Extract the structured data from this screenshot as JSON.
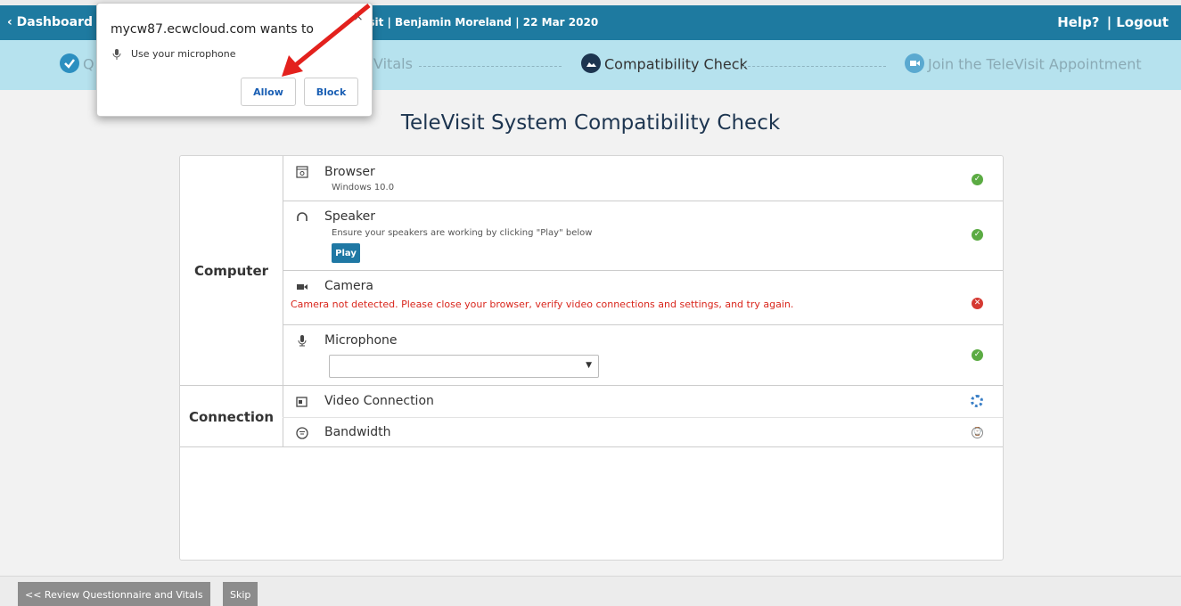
{
  "header": {
    "back_label": "Dashboard",
    "visit_info": "eVisit | Benjamin Moreland | 22 Mar 2020",
    "help_label": "Help?",
    "separator": "|",
    "logout_label": "Logout"
  },
  "steps": [
    {
      "label": "Q",
      "state": "done"
    },
    {
      "label": "Vitals",
      "state": "done"
    },
    {
      "label": "Compatibility Check",
      "state": "active"
    },
    {
      "label": "Join the TeleVisit Appointment",
      "state": "pending"
    }
  ],
  "page_title": "TeleVisit System Compatibility Check",
  "groups": {
    "computer": {
      "label": "Computer",
      "browser": {
        "title": "Browser",
        "sub": "Windows 10.0",
        "status": "ok"
      },
      "speaker": {
        "title": "Speaker",
        "sub": "Ensure your speakers are working by clicking \"Play\" below",
        "play_label": "Play",
        "status": "ok"
      },
      "camera": {
        "title": "Camera",
        "error": "Camera not detected. Please close your browser, verify video connections and settings, and try again.",
        "status": "error"
      },
      "microphone": {
        "title": "Microphone",
        "selected": "",
        "status": "ok"
      }
    },
    "connection": {
      "label": "Connection",
      "video": {
        "title": "Video Connection",
        "status": "loading"
      },
      "bandwidth": {
        "title": "Bandwidth",
        "status": "pending"
      }
    }
  },
  "footer": {
    "review_label": "<< Review Questionnaire and Vitals",
    "skip_label": "Skip"
  },
  "popup": {
    "origin": "mycw87.ecwcloud.com wants to",
    "permission": "Use your microphone",
    "close": "×",
    "allow_label": "Allow",
    "block_label": "Block"
  },
  "colors": {
    "topbar": "#1e7aa0",
    "stepper": "#b6e2ee",
    "ok": "#5bab43",
    "error": "#d53a33",
    "error_text": "#d9261c",
    "button_blue": "#1f78a4",
    "arrow": "#e3211d"
  },
  "icons": {
    "back": "chevron-left-icon",
    "browser": "browser-window-icon",
    "speaker": "headphones-icon",
    "camera": "video-camera-icon",
    "microphone": "microphone-icon",
    "video_connection": "video-connection-icon",
    "bandwidth": "wifi-icon",
    "ok": "check-circle-icon",
    "error": "x-circle-icon",
    "loading": "spinner-icon",
    "pending": "clock-icon"
  }
}
